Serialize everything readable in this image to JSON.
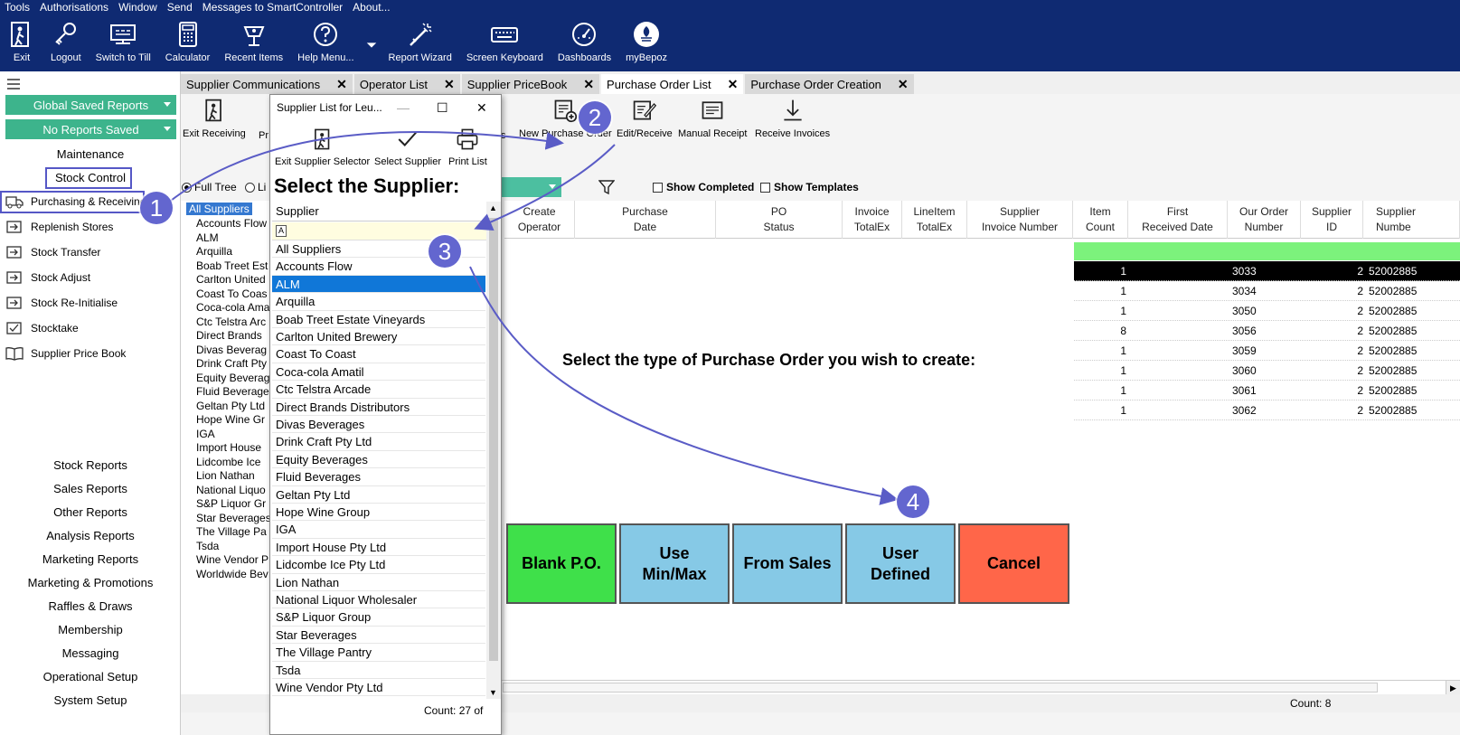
{
  "menu": [
    "Tools",
    "Authorisations",
    "Window",
    "Send",
    "Messages to SmartController",
    "About..."
  ],
  "toolbar": [
    {
      "label": "Exit",
      "icon": "exit-icon"
    },
    {
      "label": "Logout",
      "icon": "key-icon"
    },
    {
      "label": "Switch to Till",
      "icon": "till-icon"
    },
    {
      "label": "Calculator",
      "icon": "calculator-icon"
    },
    {
      "label": "Recent Items",
      "icon": "recent-icon"
    },
    {
      "label": "Help Menu...",
      "icon": "help-icon"
    },
    {
      "label": "Report Wizard",
      "icon": "wand-icon"
    },
    {
      "label": "Screen Keyboard",
      "icon": "keyboard-icon"
    },
    {
      "label": "Dashboards",
      "icon": "gauge-icon"
    },
    {
      "label": "myBepoz",
      "icon": "bepoz-icon"
    }
  ],
  "leftnav": {
    "global_reports": "Global Saved Reports",
    "no_reports": "No Reports Saved",
    "maintenance": "Maintenance",
    "stock_control": "Stock Control",
    "items": [
      "Purchasing & Receiving",
      "Replenish Stores",
      "Stock Transfer",
      "Stock Adjust",
      "Stock Re-Initialise",
      "Stocktake",
      "Supplier Price Book"
    ],
    "reports": [
      "Stock Reports",
      "Sales Reports",
      "Other Reports",
      "Analysis Reports",
      "Marketing Reports",
      "Marketing & Promotions",
      "Raffles & Draws",
      "Membership",
      "Messaging",
      "Operational Setup",
      "System Setup"
    ]
  },
  "tabs": [
    {
      "label": "Supplier Communications"
    },
    {
      "label": "Operator List"
    },
    {
      "label": "Supplier PriceBook"
    },
    {
      "label": "Purchase Order List",
      "active": true
    },
    {
      "label": "Purchase Order Creation"
    }
  ],
  "subtoolbar": {
    "exit_receiving": "Exit Receiving",
    "pr": "Pr",
    "s": "s",
    "new_po": "New Purchase Order",
    "edit_receive": "Edit/Receive",
    "manual_receipt": "Manual Receipt",
    "receive_invoices": "Receive Invoices"
  },
  "filters": {
    "full_tree": "Full Tree",
    "li": "Li",
    "show_completed": "Show Completed",
    "show_templates": "Show Templates"
  },
  "tree": {
    "root": "All Suppliers",
    "items": [
      "Accounts Flow",
      "ALM",
      "Arquilla",
      "Boab Treet Est",
      "Carlton United",
      "Coast To Coas",
      "Coca-cola Ama",
      "Ctc Telstra Arc",
      "Direct Brands",
      "Divas Beverag",
      "Drink Craft Pty",
      "Equity Beverag",
      "Fluid Beverage",
      "Geltan Pty Ltd",
      "Hope Wine Gr",
      "IGA",
      "Import House",
      "Lidcombe Ice",
      "Lion Nathan",
      "National Liquo",
      "S&P Liquor Gr",
      "Star Beverages",
      "The Village Pa",
      "Tsda",
      "Wine Vendor P",
      "Worldwide Bev"
    ]
  },
  "grid": {
    "headers": [
      {
        "l1": "Create",
        "l2": "Operator"
      },
      {
        "l1": "Purchase",
        "l2": "Date"
      },
      {
        "l1": "PO",
        "l2": "Status"
      },
      {
        "l1": "Invoice",
        "l2": "TotalEx"
      },
      {
        "l1": "LineItem",
        "l2": "TotalEx"
      },
      {
        "l1": "Supplier",
        "l2": "Invoice Number"
      },
      {
        "l1": "Item",
        "l2": "Count"
      },
      {
        "l1": "First",
        "l2": "Received Date"
      },
      {
        "l1": "Our Order",
        "l2": "Number"
      },
      {
        "l1": "Supplier",
        "l2": "ID"
      },
      {
        "l1": "Supplier",
        "l2": "Numbe"
      }
    ],
    "rows": [
      {
        "count": "1",
        "order": "3033",
        "id": "2",
        "num": "52002885"
      },
      {
        "count": "1",
        "order": "3034",
        "id": "2",
        "num": "52002885"
      },
      {
        "count": "1",
        "order": "3050",
        "id": "2",
        "num": "52002885"
      },
      {
        "count": "8",
        "order": "3056",
        "id": "2",
        "num": "52002885"
      },
      {
        "count": "1",
        "order": "3059",
        "id": "2",
        "num": "52002885"
      },
      {
        "count": "1",
        "order": "3060",
        "id": "2",
        "num": "52002885"
      },
      {
        "count": "1",
        "order": "3061",
        "id": "2",
        "num": "52002885"
      },
      {
        "count": "1",
        "order": "3062",
        "id": "2",
        "num": "52002885"
      }
    ],
    "count": "Count: 8"
  },
  "po_type": {
    "prompt": "Select the type of Purchase Order you wish to create:",
    "blank": "Blank P.O.",
    "minmax_1": "Use",
    "minmax_2": "Min/Max",
    "from_sales": "From Sales",
    "user_1": "User",
    "user_2": "Defined",
    "cancel": "Cancel"
  },
  "popup": {
    "title": "Supplier List for Leu...",
    "exit_selector": "Exit Supplier Selector",
    "select_supplier": "Select Supplier",
    "print_list": "Print List",
    "heading": "Select the Supplier:",
    "column": "Supplier",
    "filter_marker": "A",
    "items": [
      "All Suppliers",
      "Accounts Flow",
      "ALM",
      "Arquilla",
      "Boab Treet Estate Vineyards",
      "Carlton United Brewery",
      "Coast To Coast",
      "Coca-cola Amatil",
      "Ctc Telstra Arcade",
      "Direct Brands Distributors",
      "Divas Beverages",
      "Drink Craft Pty Ltd",
      "Equity Beverages",
      "Fluid Beverages",
      "Geltan Pty Ltd",
      "Hope Wine Group",
      "IGA",
      "Import House Pty Ltd",
      "Lidcombe Ice Pty Ltd",
      "Lion Nathan",
      "National Liquor Wholesaler",
      "S&P Liquor Group",
      "Star Beverages",
      "The Village Pantry",
      "Tsda",
      "Wine Vendor Pty Ltd"
    ],
    "selected": "ALM",
    "count": "Count: 27 of"
  },
  "annotations": [
    "1",
    "2",
    "3",
    "4"
  ],
  "colors": {
    "header_bg": "#0f2a72",
    "accent_green": "#3db48c",
    "annotation": "#6366cf",
    "blank_po": "#3fe04a",
    "blue_btn": "#86c9e6",
    "cancel": "#ff6649",
    "selected": "#1077d8"
  }
}
